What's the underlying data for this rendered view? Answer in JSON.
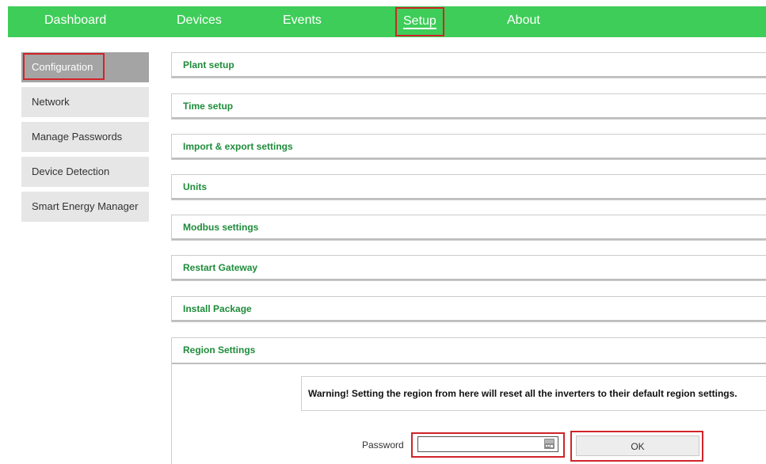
{
  "nav": {
    "items": [
      {
        "label": "Dashboard"
      },
      {
        "label": "Devices"
      },
      {
        "label": "Events"
      },
      {
        "label": "Setup"
      },
      {
        "label": "About"
      }
    ],
    "active": "Setup"
  },
  "sidebar": {
    "items": [
      {
        "label": "Configuration"
      },
      {
        "label": "Network"
      },
      {
        "label": "Manage Passwords"
      },
      {
        "label": "Device Detection"
      },
      {
        "label": "Smart Energy Manager"
      }
    ],
    "active": "Configuration"
  },
  "panels": [
    {
      "title": "Plant setup"
    },
    {
      "title": "Time setup"
    },
    {
      "title": "Import & export settings"
    },
    {
      "title": "Units"
    },
    {
      "title": "Modbus settings"
    },
    {
      "title": "Restart Gateway"
    },
    {
      "title": "Install Package"
    }
  ],
  "region": {
    "title": "Region Settings",
    "warning": "Warning! Setting the region from here will reset all the inverters to their default region settings.",
    "password_label": "Password",
    "password_value": "",
    "ok_label": "OK"
  },
  "colors": {
    "nav_bg": "#3dcd58",
    "highlight": "#d0242a",
    "panel_title": "#1e8c3a",
    "sidebar_active": "#a4a4a4",
    "sidebar_bg": "#e6e6e6"
  },
  "icons": {
    "password_field": "key-icon"
  }
}
